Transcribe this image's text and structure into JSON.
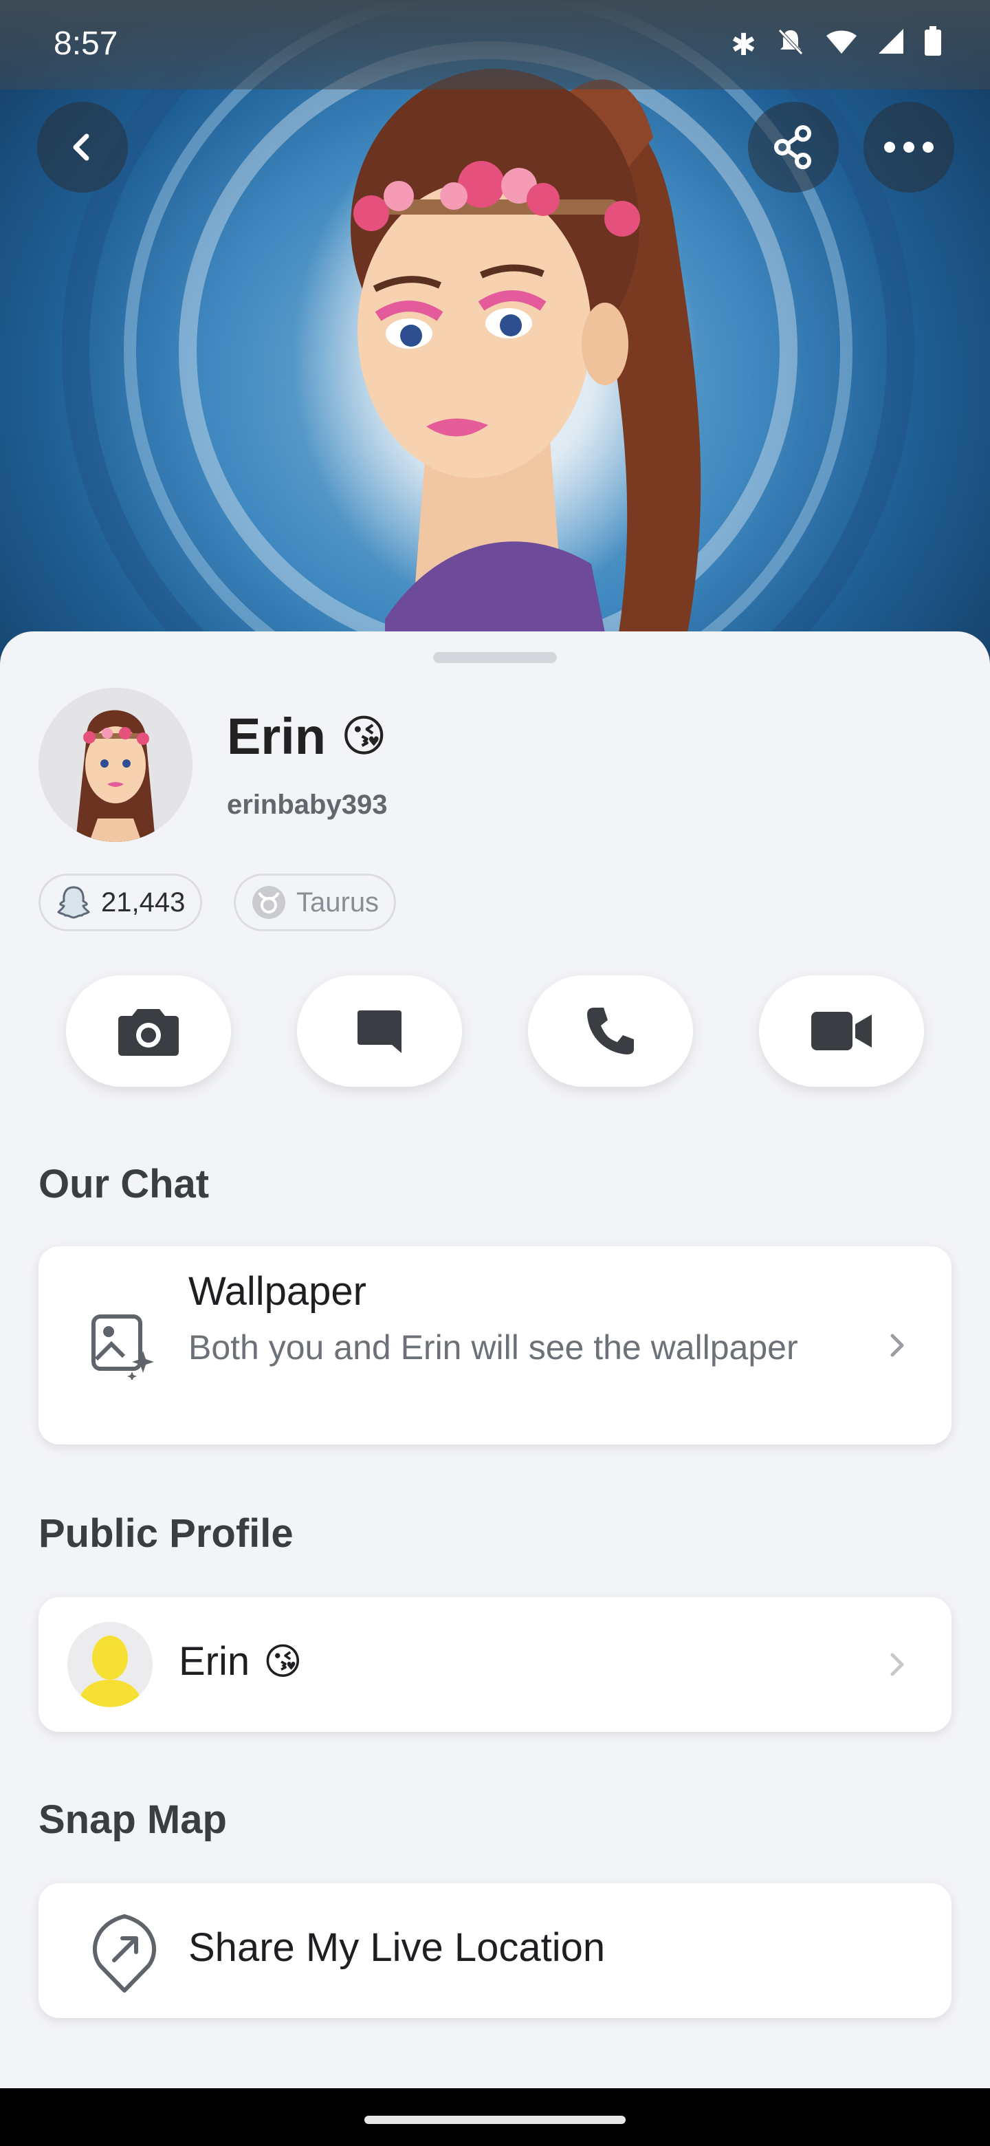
{
  "status_bar": {
    "time": "8:57",
    "icons": [
      "bluetooth-icon",
      "bell-off-icon",
      "wifi-icon",
      "signal-icon",
      "battery-icon"
    ]
  },
  "header": {
    "back_icon": "chevron-left-icon",
    "share_icon": "share-icon",
    "more_icon": "more-dots-icon"
  },
  "profile": {
    "display_name": "Erin",
    "name_emoji": "😘",
    "username": "erinbaby393",
    "snap_score": "21,443",
    "zodiac": "Taurus"
  },
  "actions": [
    {
      "icon": "camera-icon"
    },
    {
      "icon": "chat-icon"
    },
    {
      "icon": "phone-icon"
    },
    {
      "icon": "video-icon"
    }
  ],
  "sections": {
    "our_chat": {
      "title": "Our Chat",
      "wallpaper": {
        "title": "Wallpaper",
        "subtitle": "Both you and Erin will see the wallpaper"
      }
    },
    "public_profile": {
      "title": "Public Profile",
      "item_name": "Erin",
      "item_emoji": "😘"
    },
    "snap_map": {
      "title": "Snap Map",
      "item_label": "Share My Live Location"
    }
  },
  "colors": {
    "sheet_bg": "#f3f4f8",
    "card_bg": "#ffffff",
    "ghost_yellow": "#f7e034"
  }
}
